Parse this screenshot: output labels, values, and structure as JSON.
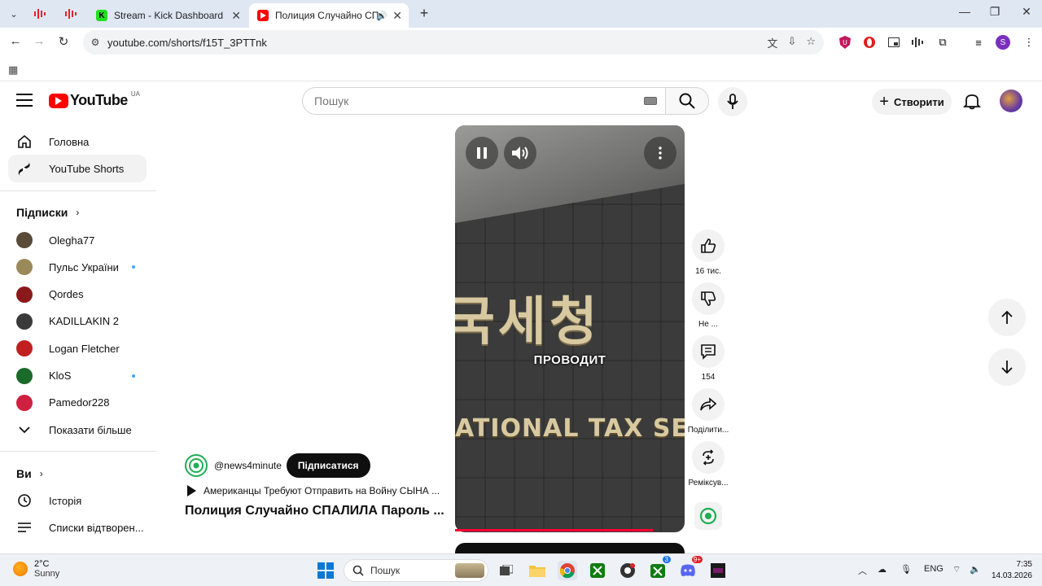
{
  "browser": {
    "tabs": [
      {
        "title": "Stream - Kick Dashboard",
        "active": false
      },
      {
        "title": "Полиция Случайно СПАЛИЛ",
        "active": true
      }
    ],
    "url": "youtube.com/shorts/f15T_3PTTnk"
  },
  "header": {
    "logo_text": "YouTube",
    "country_code": "UA",
    "search_placeholder": "Пошук",
    "create_label": "Створити"
  },
  "sidebar": {
    "top": [
      {
        "label": "Головна",
        "icon": "home-icon"
      },
      {
        "label": "YouTube Shorts",
        "icon": "shorts-icon"
      }
    ],
    "subscriptions_heading": "Підписки",
    "subscriptions": [
      {
        "label": "Olegha77",
        "color": "#5a4a3a",
        "new": false
      },
      {
        "label": "Пульс України",
        "color": "#9a8a5a",
        "new": true
      },
      {
        "label": "Qordes",
        "color": "#8a1a1a",
        "new": false
      },
      {
        "label": "KADILLAKIN 2",
        "color": "#3a3a3a",
        "new": false
      },
      {
        "label": "Logan Fletcher",
        "color": "#c02020",
        "new": false
      },
      {
        "label": "KloS",
        "color": "#1a6a2a",
        "new": true
      },
      {
        "label": "Pamedor228",
        "color": "#d02040",
        "new": false
      }
    ],
    "show_more": "Показати більше",
    "you_heading": "Ви",
    "you_items": [
      {
        "label": "Історія",
        "icon": "history-icon"
      },
      {
        "label": "Списки відтворен...",
        "icon": "playlist-icon"
      }
    ]
  },
  "short": {
    "caption": "ПРОВОДИТ",
    "sign_korean": "국세청",
    "sign_english": "ATIONAL TAX SER",
    "progress": 0.86,
    "channel": "@news4minute",
    "subscribe_label": "Підписатися",
    "playlist": "Американцы Требуют Отправить на Войну СЫНА ...",
    "title": "Полиция Случайно СПАЛИЛА Пароль ..."
  },
  "actions": {
    "like": "16 тис.",
    "dislike": "Не ...",
    "comments": "154",
    "share": "Поділити...",
    "remix": "Реміксув..."
  },
  "taskbar": {
    "temp": "2°C",
    "weather": "Sunny",
    "search_label": "Пошук",
    "lang": "ENG",
    "time": "7:35",
    "date": "14.03.2026",
    "badge_xbox": "3",
    "badge_discord": "9+"
  }
}
